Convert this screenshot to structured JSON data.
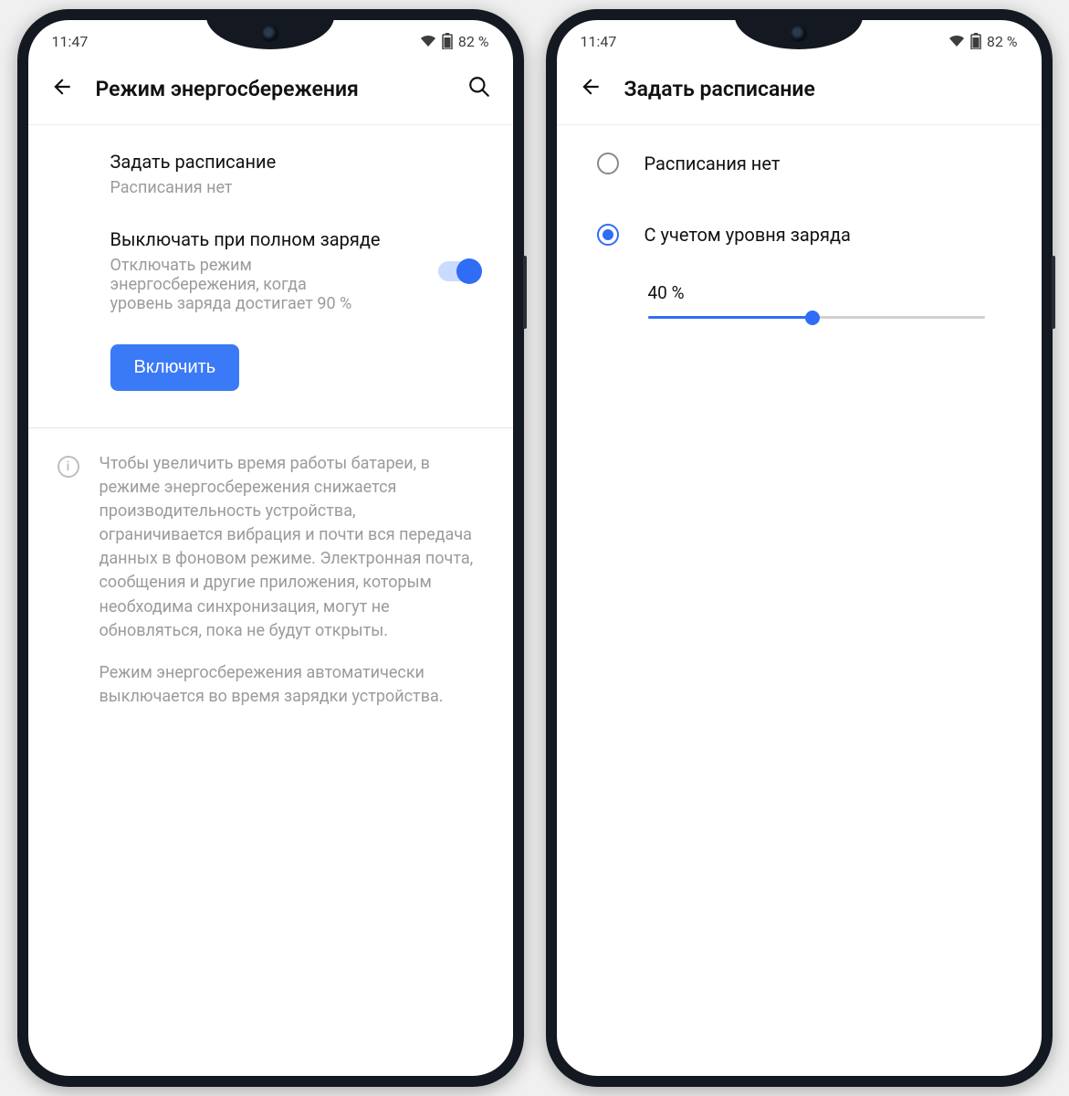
{
  "status": {
    "time": "11:47",
    "battery_pct": "82 %"
  },
  "screen1": {
    "title": "Режим энергосбережения",
    "schedule": {
      "title": "Задать расписание",
      "sub": "Расписания нет"
    },
    "full_charge": {
      "title": "Выключать при полном заряде",
      "sub": "Отключать режим энергосбережения, когда уровень заряда достигает 90 %"
    },
    "enable_btn": "Включить",
    "info_p1": "Чтобы увеличить время работы батареи, в режиме энергосбережения снижается производительность устройства, ограничивается вибрация и почти вся передача данных в фоновом режиме. Электронная почта, сообщения и другие приложения, которым необходима синхронизация, могут не обновляться, пока не будут открыты.",
    "info_p2": "Режим энергосбережения автоматически выключается во время зарядки устройства."
  },
  "screen2": {
    "title": "Задать расписание",
    "opt_none": "Расписания нет",
    "opt_by_level": "С учетом уровня заряда",
    "slider_label": "40 %",
    "slider_value": 40
  }
}
